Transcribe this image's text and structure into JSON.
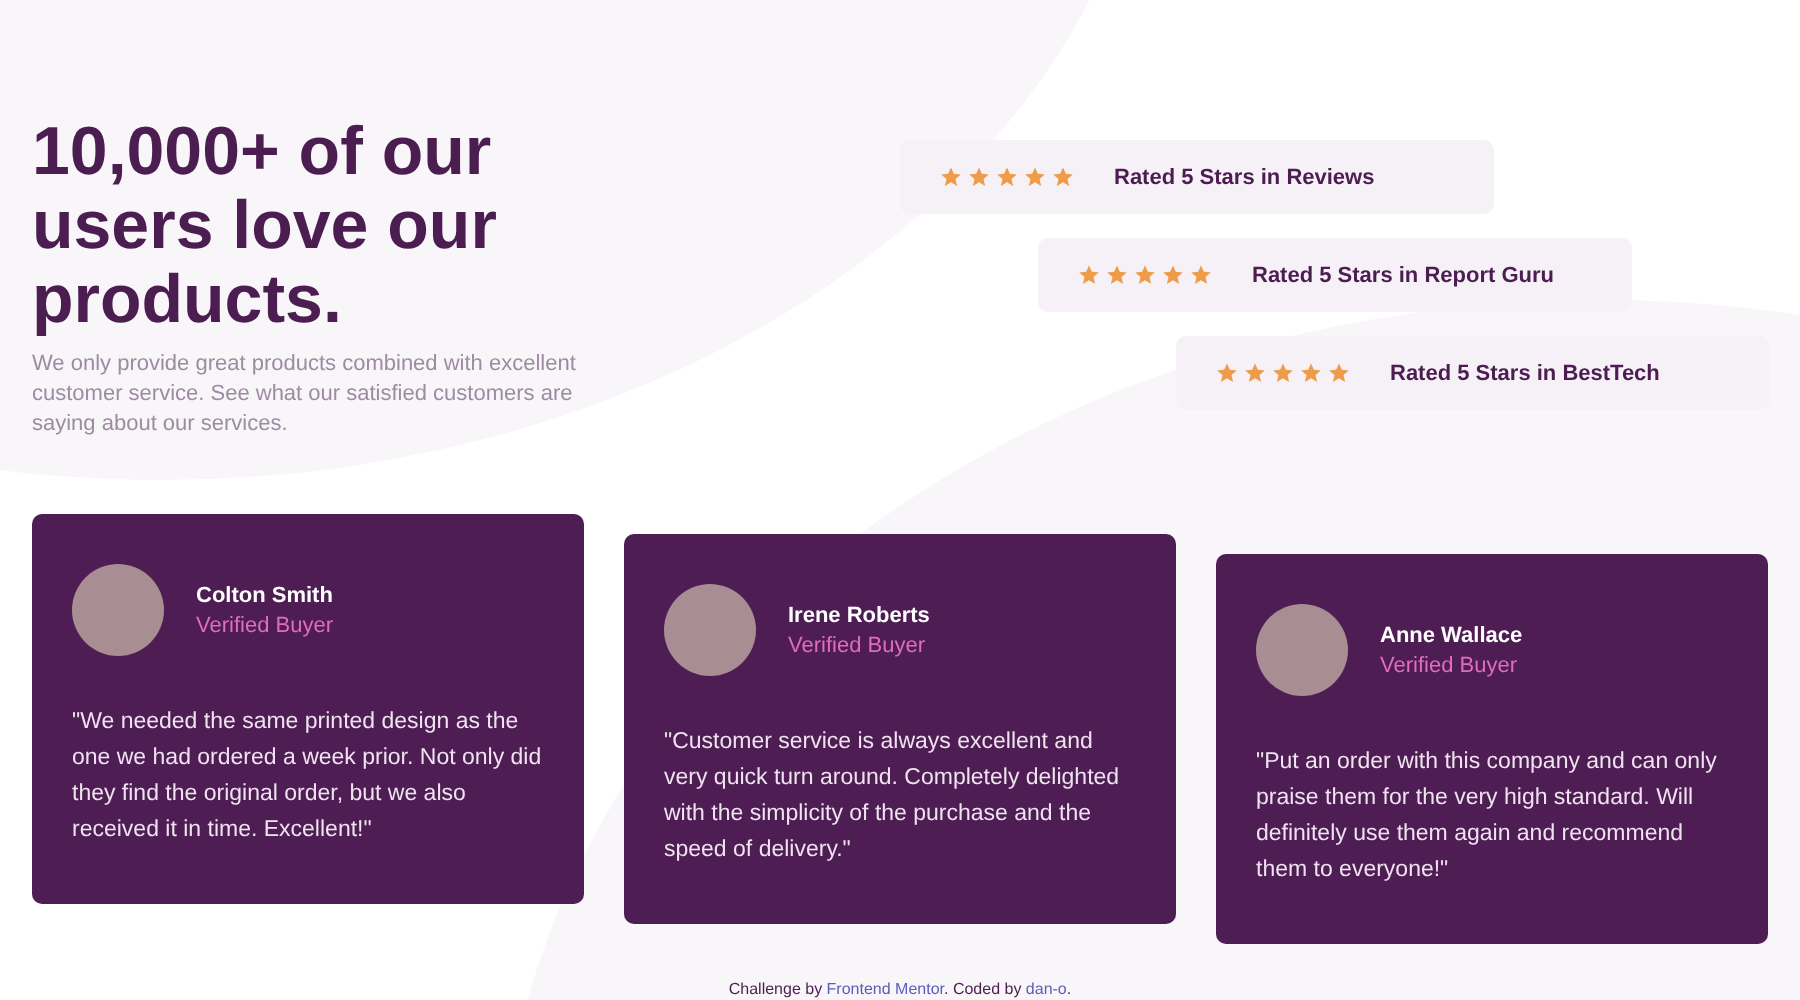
{
  "hero": {
    "heading": "10,000+ of our users love our products.",
    "description": "We only provide great products combined with excellent customer service. See what our satisfied customers are saying about our services."
  },
  "ratings": [
    {
      "stars": 5,
      "label": "Rated 5 Stars in Reviews"
    },
    {
      "stars": 5,
      "label": "Rated 5 Stars in Report Guru"
    },
    {
      "stars": 5,
      "label": "Rated 5 Stars in BestTech"
    }
  ],
  "testimonials": [
    {
      "name": "Colton Smith",
      "role": "Verified Buyer",
      "quote": "\"We needed the same printed design as the one we had ordered a week prior. Not only did they find the original order, but we also received it in time. Excellent!\""
    },
    {
      "name": "Irene Roberts",
      "role": "Verified Buyer",
      "quote": "\"Customer service is always excellent and very quick turn around. Completely delighted with the simplicity of the purchase and the speed of delivery.\""
    },
    {
      "name": "Anne Wallace",
      "role": "Verified Buyer",
      "quote": "\"Put an order with this company and can only praise them for the very high standard. Will definitely use them again and recommend them to everyone!\""
    }
  ],
  "footer": {
    "parts": [
      {
        "kind": "text",
        "text": "Challenge by "
      },
      {
        "kind": "link",
        "text": "Frontend Mentor"
      },
      {
        "kind": "text",
        "text": ". Coded by "
      },
      {
        "kind": "link",
        "text": "dan-o"
      },
      {
        "kind": "text",
        "text": "."
      }
    ]
  }
}
